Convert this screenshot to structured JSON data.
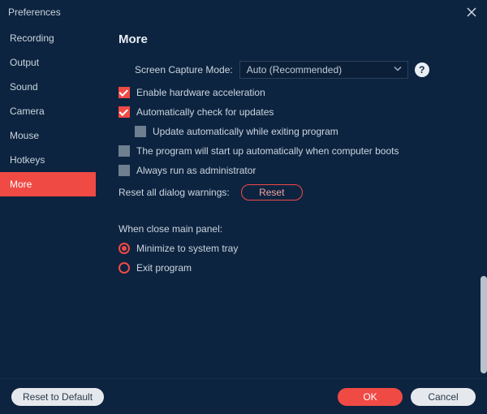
{
  "window": {
    "title": "Preferences"
  },
  "sidebar": {
    "items": [
      {
        "label": "Recording",
        "active": false
      },
      {
        "label": "Output",
        "active": false
      },
      {
        "label": "Sound",
        "active": false
      },
      {
        "label": "Camera",
        "active": false
      },
      {
        "label": "Mouse",
        "active": false
      },
      {
        "label": "Hotkeys",
        "active": false
      },
      {
        "label": "More",
        "active": true
      }
    ]
  },
  "main": {
    "heading": "More",
    "capture_mode_label": "Screen Capture Mode:",
    "capture_mode_value": "Auto (Recommended)",
    "help_glyph": "?",
    "check_hw": "Enable hardware acceleration",
    "check_updates": "Automatically check for updates",
    "check_update_exit": "Update automatically while exiting program",
    "check_startup": "The program will start up automatically when computer boots",
    "check_admin": "Always run as administrator",
    "reset_warnings_label": "Reset all dialog warnings:",
    "reset_btn": "Reset",
    "close_panel_label": "When close main panel:",
    "radio_tray": "Minimize to system tray",
    "radio_exit": "Exit program"
  },
  "footer": {
    "reset_default": "Reset to Default",
    "ok": "OK",
    "cancel": "Cancel"
  }
}
